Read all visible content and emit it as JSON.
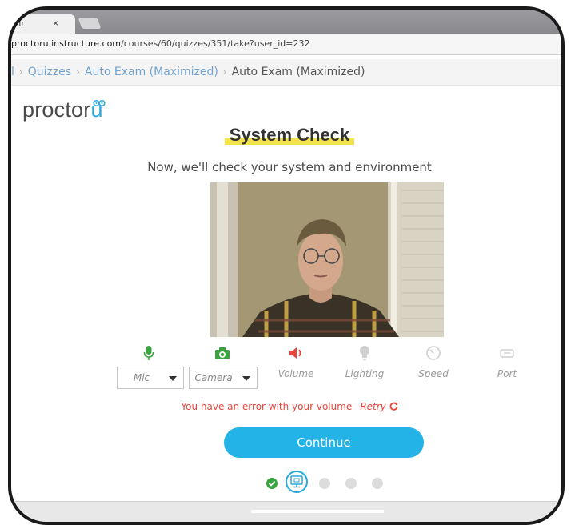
{
  "browser": {
    "tab_title": "ctr",
    "tab_close": "×",
    "url_host": "proctoru.instructure.com",
    "url_path": "/courses/60/quizzes/351/take?user_id=232"
  },
  "breadcrumbs": {
    "items": [
      "Quizzes",
      "Auto Exam (Maximized)"
    ],
    "current": "Auto Exam (Maximized)",
    "separator": "›",
    "leading": "l"
  },
  "logo": {
    "text": "proctor",
    "accent": "u"
  },
  "system_check": {
    "title": "System Check",
    "subtitle": "Now, we'll check your system and environment"
  },
  "checks": [
    {
      "name": "mic",
      "label": "Mic",
      "icon": "microphone-icon",
      "color": "#3aa441"
    },
    {
      "name": "camera",
      "label": "Camera",
      "icon": "camera-icon",
      "color": "#3aa441"
    },
    {
      "name": "volume",
      "label": "Volume",
      "icon": "speaker-icon",
      "color": "#e4473f"
    },
    {
      "name": "lighting",
      "label": "Lighting",
      "icon": "lightbulb-icon",
      "color": "#cfcfcf"
    },
    {
      "name": "speed",
      "label": "Speed",
      "icon": "speedometer-icon",
      "color": "#cfcfcf"
    },
    {
      "name": "port",
      "label": "Port",
      "icon": "port-icon",
      "color": "#cfcfcf"
    }
  ],
  "error": {
    "message": "You have an error with your volume",
    "retry": "Retry"
  },
  "continue_label": "Continue",
  "colors": {
    "accent": "#24b3e6",
    "success": "#3aa441",
    "error": "#e4473f",
    "highlight": "#f3e24c"
  }
}
